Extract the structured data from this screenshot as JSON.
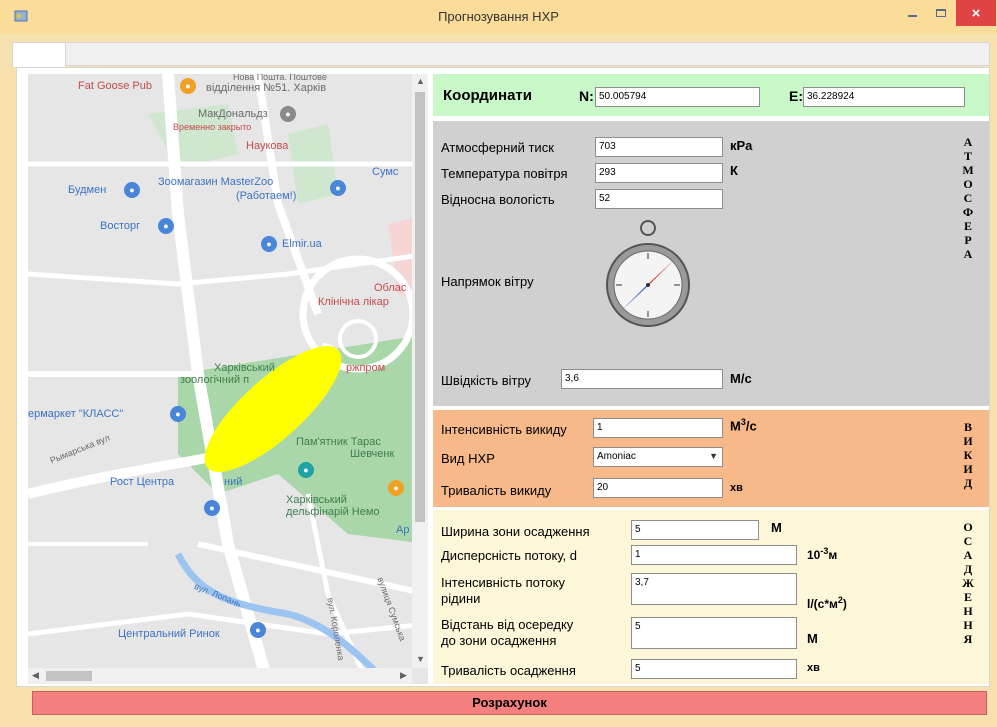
{
  "window": {
    "title": "Прогнозування НХР",
    "close_glyph": "×",
    "app_icon": "app-icon",
    "colors": {
      "titlebar": "#fbdc98",
      "close": "#e04343"
    }
  },
  "map": {
    "labels": {
      "fatgoose": "Fat Goose Pub",
      "branch": "відділення №51. Харків",
      "branch_top": "Нова Пошта. Поштове",
      "mcd": "МакДональдз",
      "mcd_status": "Временно закрыто",
      "naukova": "Наукова",
      "sumska": "Сумс",
      "budmen": "Будмен",
      "zoomag": "Зоомагазин MasterZoo",
      "zoomag_sub": "(Работаем!)",
      "vostorg": "Восторг",
      "elmir": "Elmir.ua",
      "oblast": "Облас",
      "clinic": "Клінічна лікар",
      "zoo1": "Харківський",
      "zoo2": "зоологічний п",
      "derzh": "ржпром",
      "market": "ермаркет \"КЛАСС\"",
      "monument1": "Пам'ятник Тарас",
      "monument2": "Шевченк",
      "rost": "Рост Центра",
      "rost_tail": "ний",
      "dolph1": "Харківський",
      "dolph2": "дельфінарій Немо",
      "ap": "Ар",
      "central": "Центральний Ринок",
      "street1": "вул. Лопань",
      "street2": "Рымарська вул",
      "street3": "вул. Короленка",
      "street4": "вулиця Сумська"
    },
    "plume_color": "#ffff00"
  },
  "coords": {
    "title": "Координати",
    "n_label": "N:",
    "n_value": "50.005794",
    "e_label": "E:",
    "e_value": "36.228924"
  },
  "atmosphere": {
    "section": "А\nТ\nМ\nО\nС\nФ\nЕ\nР\nА",
    "pressure_label": "Атмосферний тиск",
    "pressure_value": "703",
    "pressure_unit": "кPa",
    "temp_label": "Температура повітря",
    "temp_value": "293",
    "temp_unit": "К",
    "humidity_label": "Відносна вологість",
    "humidity_value": "52",
    "wind_dir_label": "Напрямок вітру",
    "wind_speed_label": "Швідкість вітру",
    "wind_speed_value": "3,6",
    "wind_speed_unit": "М/с",
    "compass_icon": "compass-icon"
  },
  "emission": {
    "section": "В\nИ\nК\nИ\nД",
    "intensity_label": "Інтенсивність викиду",
    "intensity_value": "1",
    "intensity_unit_base": "М",
    "intensity_unit_sup": "3",
    "intensity_unit_tail": "/с",
    "type_label": "Вид НХР",
    "type_value": "Amoniac",
    "duration_label": "Тривалість викиду",
    "duration_value": "20",
    "duration_unit": "хв"
  },
  "deposition": {
    "section": "О\nС\nА\nД\nЖ\nЕ\nН\nН\nЯ",
    "width_label": "Ширина зони осадження",
    "width_value": "5",
    "width_unit": "М",
    "disp_label": "Дисперсність потоку, d",
    "disp_value": "1",
    "disp_unit_base": "10",
    "disp_unit_sup": "-3",
    "disp_unit_tail": "м",
    "liq_label1": "Інтенсивність потоку",
    "liq_label2": "рідини",
    "liq_value": "3,7",
    "liq_unit_base": "l/(с*м",
    "liq_unit_sup": "2",
    "liq_unit_tail": ")",
    "dist_label1": "Відстань від осередку",
    "dist_label2": "до зони осадження",
    "dist_value": "5",
    "dist_unit": "М",
    "dur_label": "Тривалість осадження",
    "dur_value": "5",
    "dur_unit": "хв"
  },
  "actions": {
    "calc": "Розрахунок",
    "calc_color": "#f37f7f"
  }
}
